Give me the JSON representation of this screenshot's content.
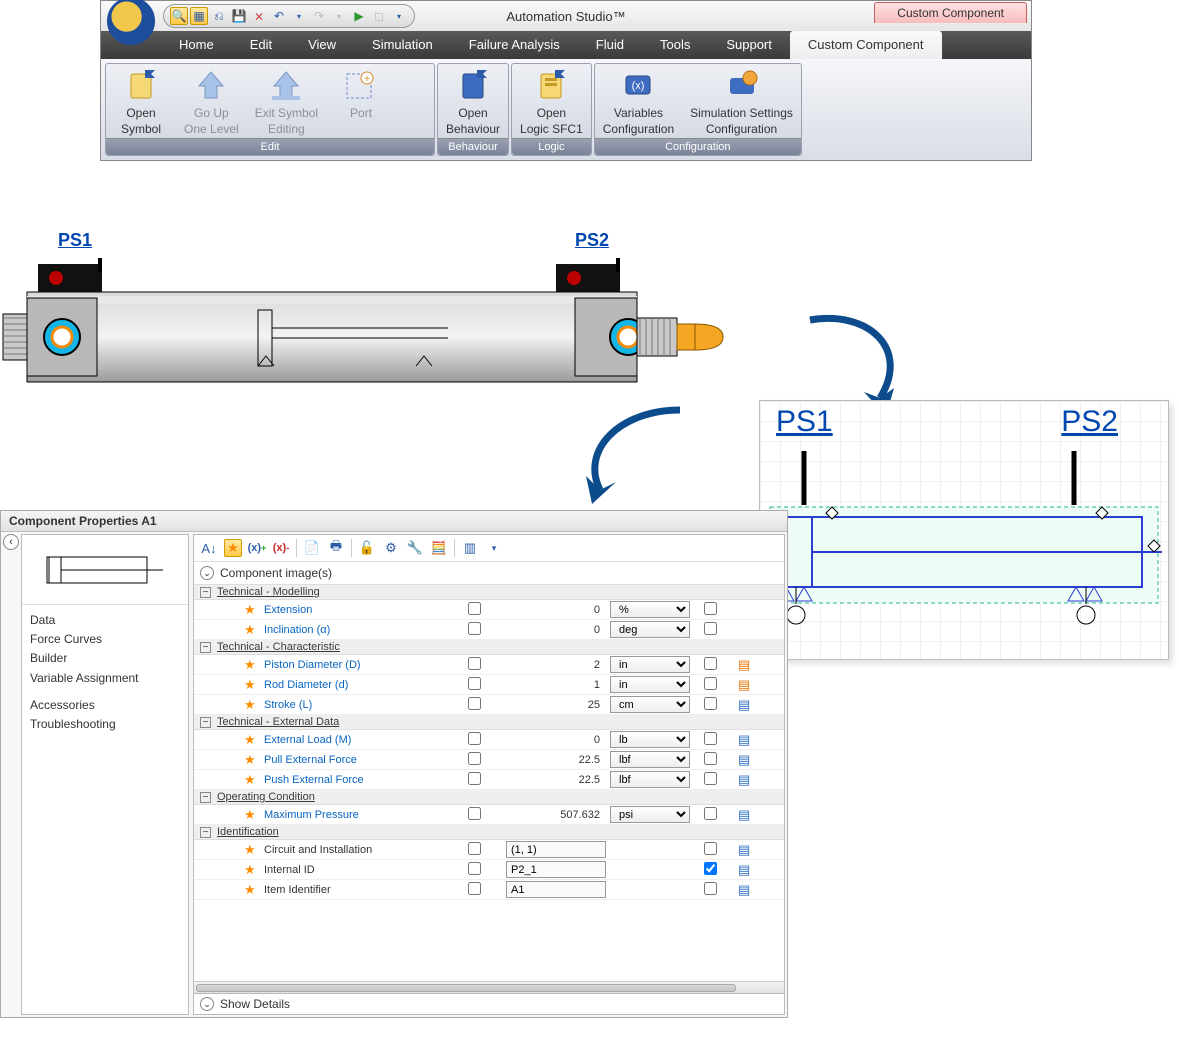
{
  "app_title": "Automation Studio™",
  "cc_tab": "Custom Component",
  "menu": [
    "Home",
    "Edit",
    "View",
    "Simulation",
    "Failure Analysis",
    "Fluid",
    "Tools",
    "Support",
    "Custom Component"
  ],
  "ribbon": {
    "groups": [
      {
        "label": "Edit",
        "items": [
          {
            "name": "open-symbol",
            "line1": "Open",
            "line2": "Symbol"
          },
          {
            "name": "go-up",
            "line1": "Go Up",
            "line2": "One Level",
            "disabled": true
          },
          {
            "name": "exit-symbol",
            "line1": "Exit Symbol",
            "line2": "Editing",
            "disabled": true
          },
          {
            "name": "port",
            "line1": "Port",
            "line2": "",
            "disabled": true
          }
        ]
      },
      {
        "label": "Behaviour",
        "items": [
          {
            "name": "open-behaviour",
            "line1": "Open",
            "line2": "Behaviour"
          }
        ]
      },
      {
        "label": "Logic",
        "items": [
          {
            "name": "open-logic",
            "line1": "Open",
            "line2": "Logic SFC1"
          }
        ]
      },
      {
        "label": "Configuration",
        "items": [
          {
            "name": "variables-config",
            "line1": "Variables",
            "line2": "Configuration"
          },
          {
            "name": "sim-settings",
            "line1": "Simulation Settings",
            "line2": "Configuration"
          }
        ]
      }
    ]
  },
  "sensors": {
    "ps1": "PS1",
    "ps2": "PS2"
  },
  "schematic": {
    "ps1": "PS1",
    "ps2": "PS2"
  },
  "props": {
    "title": "Component Properties A1",
    "nav": [
      "Data",
      "Force Curves",
      "Builder",
      "Variable Assignment",
      "",
      "Accessories",
      "Troubleshooting"
    ],
    "component_images": "Component image(s)",
    "show_details": "Show Details",
    "groups": [
      {
        "name": "Technical - Modelling",
        "rows": [
          {
            "name": "Extension",
            "val": "0",
            "unit": "%",
            "icon": ""
          },
          {
            "name": "Inclination (α)",
            "val": "0",
            "unit": "deg",
            "icon": ""
          }
        ]
      },
      {
        "name": "Technical - Characteristic",
        "rows": [
          {
            "name": "Piston Diameter (D)",
            "val": "2",
            "unit": "in",
            "icon": "orange"
          },
          {
            "name": "Rod Diameter (d)",
            "val": "1",
            "unit": "in",
            "icon": "orange"
          },
          {
            "name": "Stroke (L)",
            "val": "25",
            "unit": "cm",
            "icon": "blue"
          }
        ]
      },
      {
        "name": "Technical - External Data",
        "rows": [
          {
            "name": "External Load (M)",
            "val": "0",
            "unit": "lb",
            "icon": "blue"
          },
          {
            "name": "Pull External Force",
            "val": "22.5",
            "unit": "lbf",
            "icon": "blue"
          },
          {
            "name": "Push External Force",
            "val": "22.5",
            "unit": "lbf",
            "icon": "blue"
          }
        ]
      },
      {
        "name": "Operating Condition",
        "rows": [
          {
            "name": "Maximum Pressure",
            "val": "507.632",
            "unit": "psi",
            "icon": "blue"
          }
        ]
      },
      {
        "name": "Identification",
        "rows": [
          {
            "name": "Circuit and Installation",
            "type": "text",
            "text": "(1, 1)",
            "icon": "blue",
            "id": true
          },
          {
            "name": "Internal ID",
            "type": "text",
            "text": "P2_1",
            "icon": "blue",
            "checked": true,
            "id": true
          },
          {
            "name": "Item Identifier",
            "type": "text",
            "text": "A1",
            "icon": "blue",
            "id": true
          }
        ]
      }
    ]
  }
}
